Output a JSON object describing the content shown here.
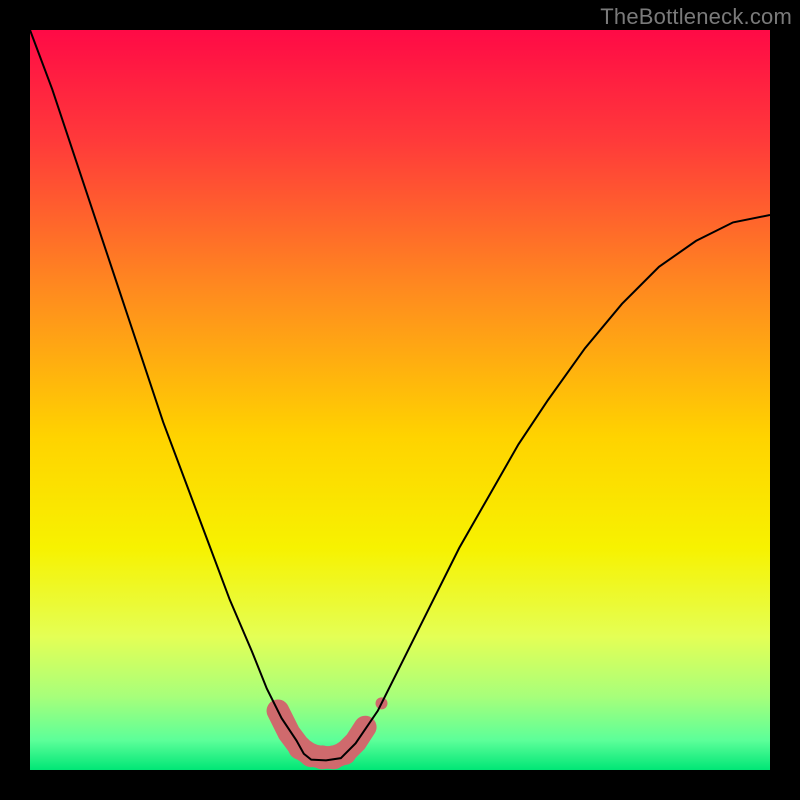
{
  "watermark": "TheBottleneck.com",
  "chart_data": {
    "type": "line",
    "title": "",
    "xlabel": "",
    "ylabel": "",
    "xlim": [
      0,
      100
    ],
    "ylim": [
      0,
      100
    ],
    "background_gradient": {
      "stops": [
        {
          "offset": 0.0,
          "color": "#ff0a46"
        },
        {
          "offset": 0.15,
          "color": "#ff3a3a"
        },
        {
          "offset": 0.35,
          "color": "#ff8a1f"
        },
        {
          "offset": 0.55,
          "color": "#ffd300"
        },
        {
          "offset": 0.7,
          "color": "#f7f200"
        },
        {
          "offset": 0.82,
          "color": "#e4ff55"
        },
        {
          "offset": 0.9,
          "color": "#a8ff7a"
        },
        {
          "offset": 0.96,
          "color": "#5cff99"
        },
        {
          "offset": 1.0,
          "color": "#00e676"
        }
      ]
    },
    "series": [
      {
        "name": "bottleneck-curve",
        "color": "#000000",
        "stroke_width": 2,
        "x": [
          0,
          3,
          6,
          9,
          12,
          15,
          18,
          21,
          24,
          27,
          30,
          32,
          34,
          36,
          37,
          38,
          40,
          42,
          44,
          47,
          50,
          54,
          58,
          62,
          66,
          70,
          75,
          80,
          85,
          90,
          95,
          100
        ],
        "y": [
          100,
          92,
          83,
          74,
          65,
          56,
          47,
          39,
          31,
          23,
          16,
          11,
          7,
          4,
          2.2,
          1.4,
          1.3,
          1.6,
          3.6,
          8,
          14,
          22,
          30,
          37,
          44,
          50,
          57,
          63,
          68,
          71.5,
          74,
          75
        ]
      }
    ],
    "markers": {
      "name": "optimal-region",
      "color": "#cf6a6d",
      "type": "rounded-band",
      "points": [
        {
          "x": 33.5,
          "y": 8.0,
          "r": 10
        },
        {
          "x": 35.0,
          "y": 5.0,
          "r": 11
        },
        {
          "x": 36.5,
          "y": 3.0,
          "r": 12
        },
        {
          "x": 38.0,
          "y": 2.0,
          "r": 12
        },
        {
          "x": 39.5,
          "y": 1.7,
          "r": 12
        },
        {
          "x": 41.0,
          "y": 1.7,
          "r": 12
        },
        {
          "x": 42.5,
          "y": 2.3,
          "r": 12
        },
        {
          "x": 44.0,
          "y": 3.8,
          "r": 11
        },
        {
          "x": 45.3,
          "y": 5.8,
          "r": 10
        }
      ],
      "outlier": {
        "x": 47.5,
        "y": 9.0,
        "r": 6
      }
    }
  }
}
